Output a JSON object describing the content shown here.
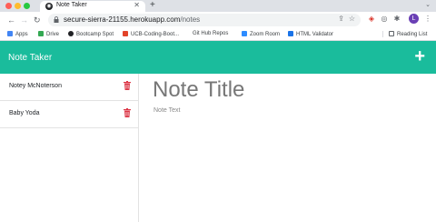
{
  "browser": {
    "tab_title": "Note Taker",
    "url_domain": "secure-sierra-21155.herokuapp.com",
    "url_path": "/notes",
    "avatar_letter": "L",
    "bookmarks": [
      {
        "label": "Apps",
        "color": "#4285f4"
      },
      {
        "label": "Drive",
        "color": "#34a853"
      },
      {
        "label": "Bootcamp Spot",
        "color": "#202124"
      },
      {
        "label": "UCB-Coding-Boot...",
        "color": "#e24329"
      },
      {
        "label": "Git Hub Repos",
        "color": "#ffffff"
      },
      {
        "label": "Zoom Room",
        "color": "#2d8cff"
      },
      {
        "label": "HTML Validator",
        "color": "#1a73e8"
      }
    ],
    "reading_list": "Reading List"
  },
  "app": {
    "title": "Note Taker",
    "add_icon": "+",
    "accent": "#1abc9c",
    "notes": [
      {
        "title": "Notey McNoterson"
      },
      {
        "title": "Baby Yoda"
      }
    ],
    "editor": {
      "title_placeholder": "Note Title",
      "text_placeholder": "Note Text"
    }
  }
}
